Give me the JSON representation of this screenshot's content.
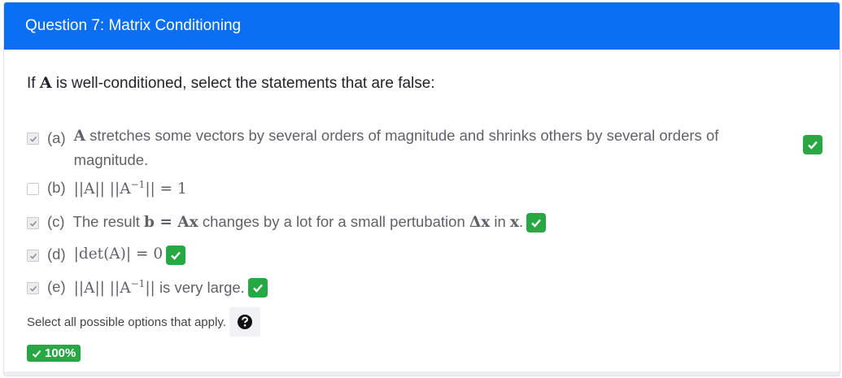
{
  "header": {
    "title": "Question 7: Matrix Conditioning"
  },
  "prompt": {
    "prefix": "If",
    "matrix": "A",
    "suffix": "is well-conditioned, select the statements that are false:"
  },
  "options": [
    {
      "letter": "(a)",
      "checked": true,
      "correct": true,
      "matrix": "A",
      "text": "stretches some vectors by several orders of magnitude and shrinks others by several orders of magnitude."
    },
    {
      "letter": "(b)",
      "checked": false,
      "correct": false,
      "expr": "||A|| ||A",
      "sup": "−1",
      "rest": "|| = 1"
    },
    {
      "letter": "(c)",
      "checked": true,
      "correct": true,
      "t1": "The result",
      "m1": "b = Ax",
      "t2": "changes by a lot for a small pertubation",
      "m2": "Δx",
      "t3": "in",
      "m3": "x",
      "t4": "."
    },
    {
      "letter": "(d)",
      "checked": true,
      "correct": true,
      "expr": "|det(A)| = 0"
    },
    {
      "letter": "(e)",
      "checked": true,
      "correct": true,
      "expr": "||A|| ||A",
      "sup": "−1",
      "rest": "||",
      "tail": "is very large."
    }
  ],
  "footer": {
    "help_text": "Select all possible options that apply.",
    "help_icon": "question-circle-icon",
    "score": "100%"
  },
  "colors": {
    "header": "#0a6ff2",
    "success": "#28a745"
  }
}
